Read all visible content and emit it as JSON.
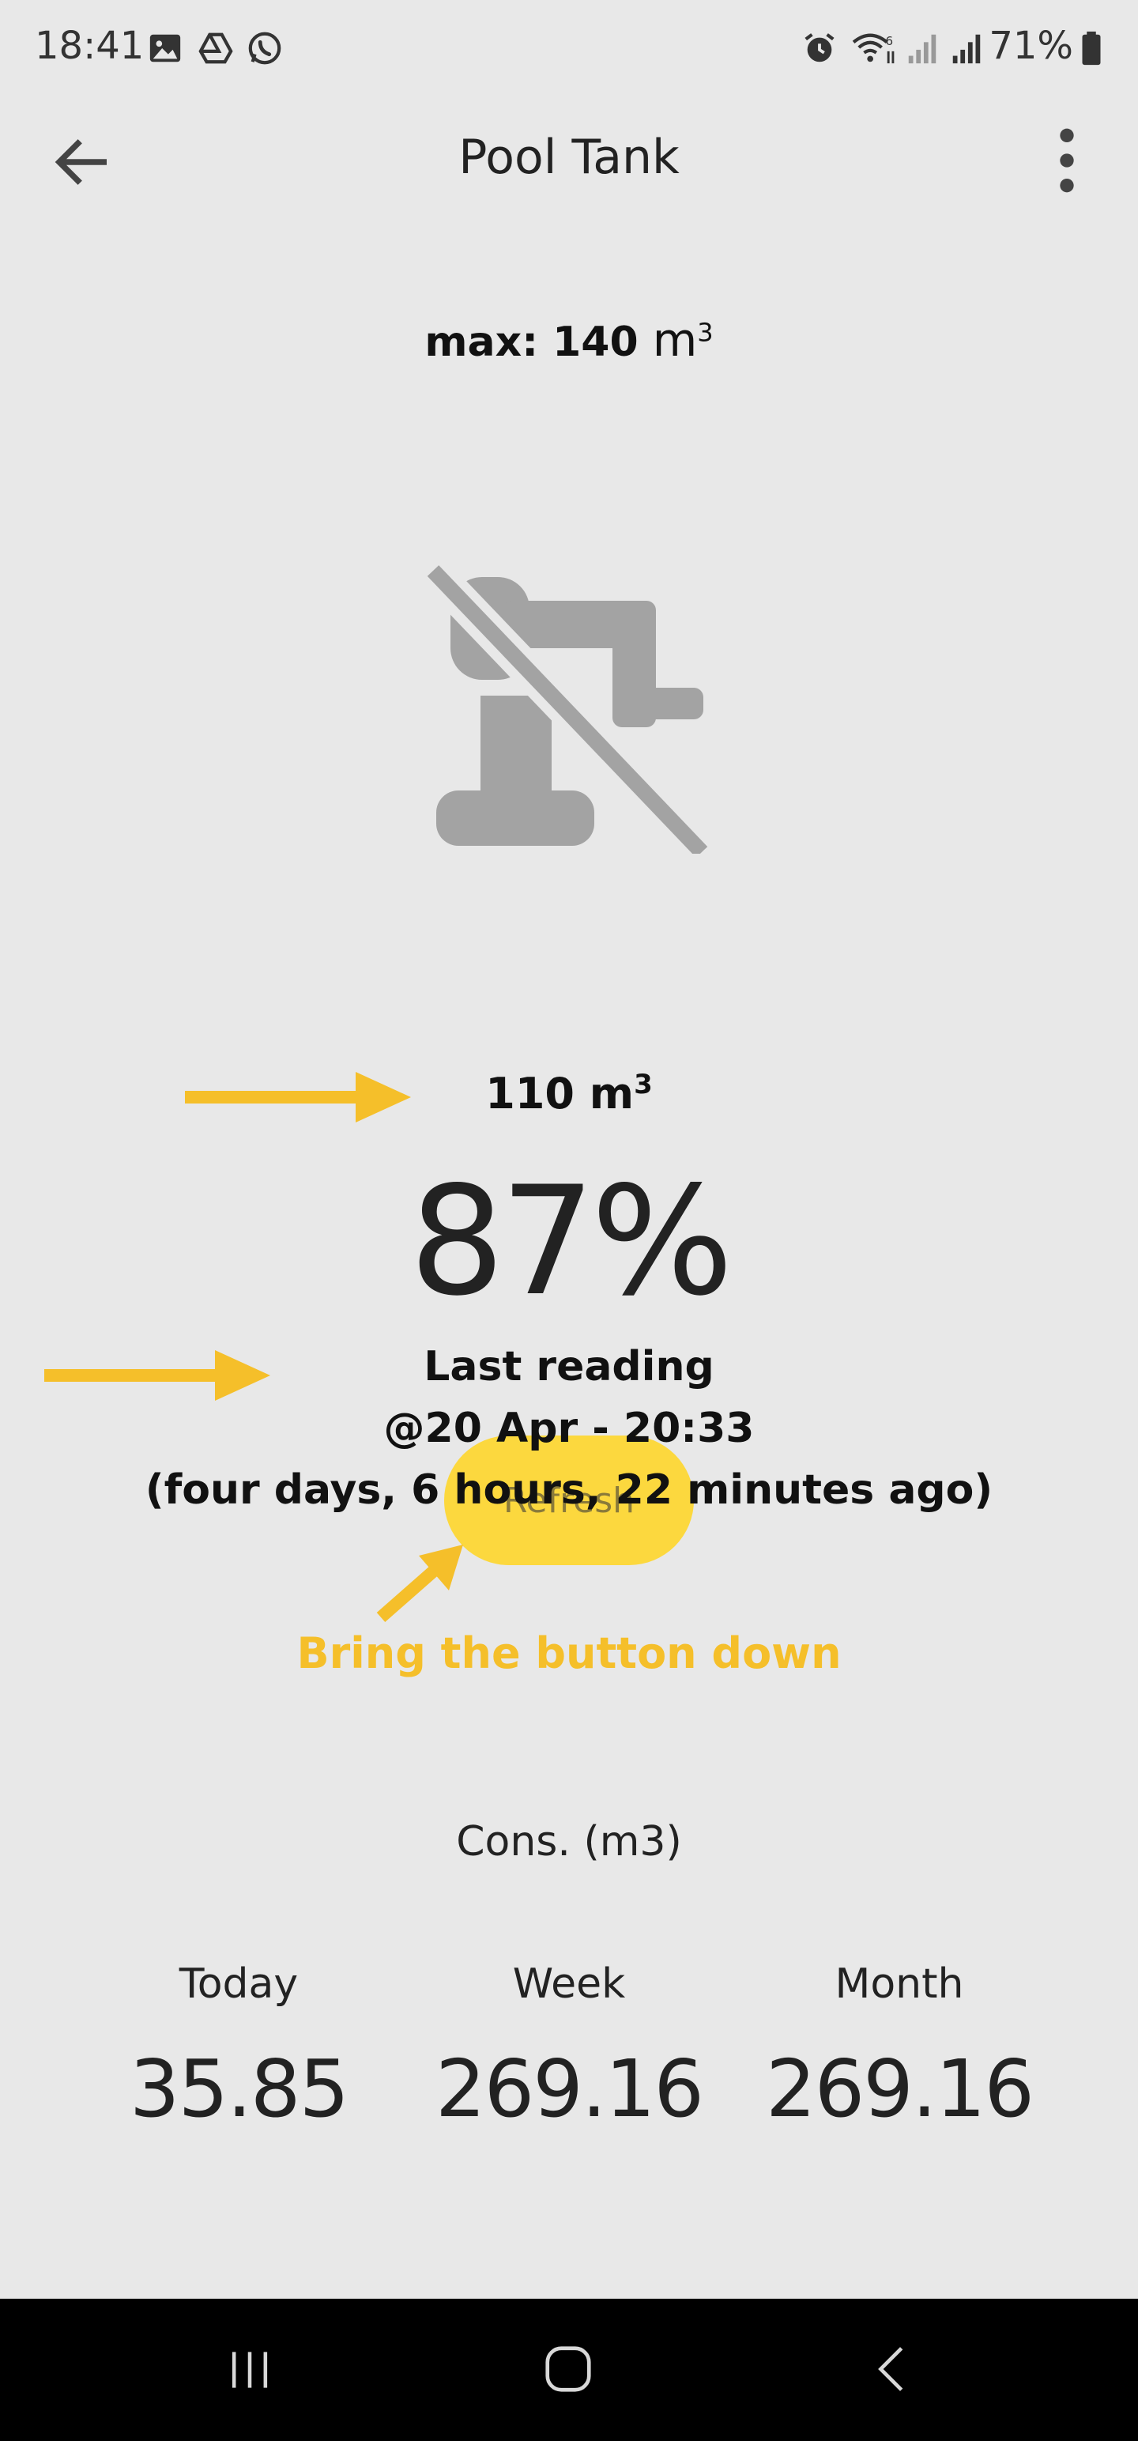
{
  "status_bar": {
    "time": "18:41",
    "battery": "71%",
    "left_icons": [
      "image-icon",
      "drive-icon",
      "whatsapp-icon"
    ],
    "right_icons": [
      "alarm-icon",
      "wifi-icon",
      "signal-icon",
      "signal-icon",
      "battery-icon"
    ]
  },
  "app_bar": {
    "title": "Pool Tank",
    "back_icon": "arrow-left-icon",
    "menu_icon": "more-vert-icon"
  },
  "tank": {
    "max_prefix": "max: 140",
    "max_unit": "m",
    "max_unit_exp": "3",
    "volume_value": "110 m",
    "volume_exp": "3",
    "percent": "87%",
    "last_reading_line1": "Last reading",
    "last_reading_line2": "@20 Apr - 20:33",
    "last_reading_line3": "(four days, 6 hours, 22 minutes ago)",
    "refresh_label": "Refresh",
    "status_icon": "robot-off-icon"
  },
  "annotation": {
    "text": "Bring the button down",
    "color": "#f5bf2a"
  },
  "consumption": {
    "title": "Cons. (m3)",
    "columns": [
      {
        "label": "Today",
        "value": "35.85"
      },
      {
        "label": "Week",
        "value": "269.16"
      },
      {
        "label": "Month",
        "value": "269.16"
      }
    ]
  },
  "colors": {
    "background": "#e8e8e8",
    "accent": "#fcd83e",
    "nav_bar": "#000000"
  }
}
